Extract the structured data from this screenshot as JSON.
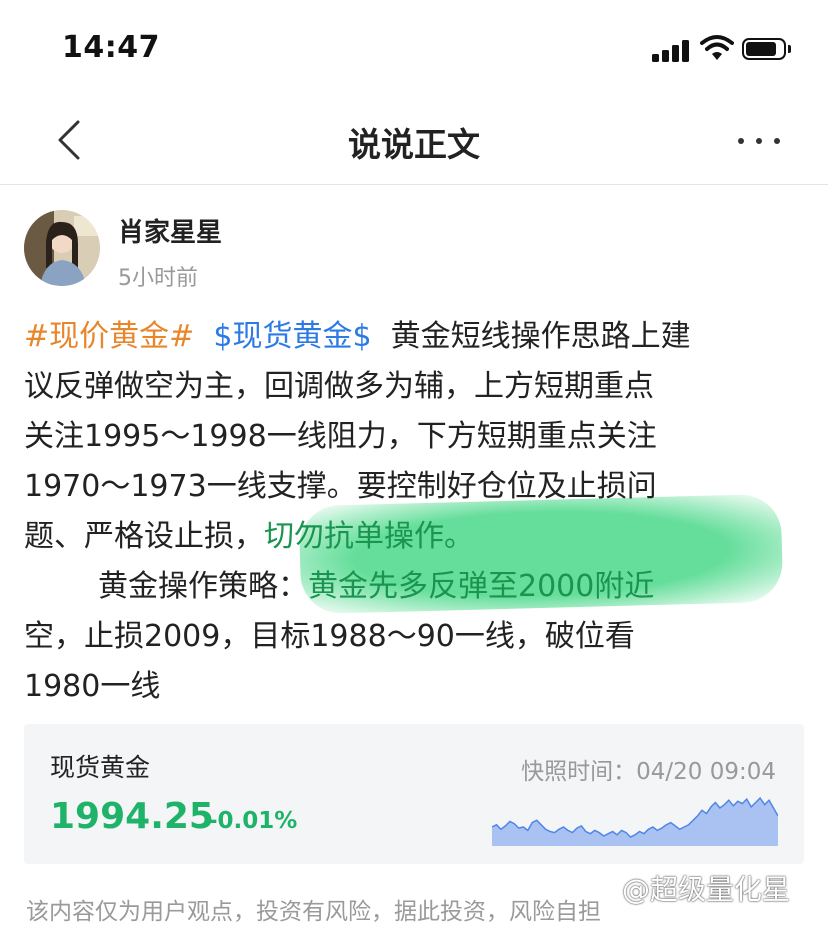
{
  "status_bar": {
    "time": "14:47"
  },
  "nav": {
    "title": "说说正文"
  },
  "author": {
    "name": "肖家星星",
    "posted": "5小时前"
  },
  "post": {
    "topic_tag": "#现价黄金#",
    "stock_tag": "$现货黄金$",
    "para1_a": "黄金短线操作思路上建",
    "para1_b": "议反弹做空为主，回调做多为辅，上方短期重点",
    "para1_c": "关注1995～1998一线阻力，下方短期重点关注",
    "para1_d": "1970～1973一线支撑。要控制好仓位及止损问",
    "para1_e": "题、严格设止损，",
    "para1_e2": "切勿抗单操作。",
    "para2_a": "黄金操作策略：",
    "para2_a2": "黄金先多反弹至2000附近",
    "para2_b": "空，止损2009，目标1988～90一线，破位看",
    "para2_c": "1980一线"
  },
  "quote": {
    "name": "现货黄金",
    "price": "1994.25",
    "change": "-0.01%",
    "snapshot_label": "快照时间：04/20 09:04",
    "spark_color": "#4f86e8",
    "spark_values": [
      40,
      42,
      38,
      41,
      45,
      43,
      39,
      40,
      37,
      44,
      46,
      42,
      38,
      36,
      35,
      38,
      40,
      37,
      35,
      39,
      41,
      36,
      34,
      37,
      35,
      32,
      34,
      36,
      33,
      37,
      35,
      31,
      33,
      36,
      34,
      38,
      40,
      37,
      39,
      42,
      44,
      41,
      38,
      40,
      42,
      46,
      50,
      55,
      52,
      58,
      62,
      57,
      60,
      64,
      59,
      63,
      61,
      65,
      58,
      62,
      66,
      60,
      64,
      57,
      50
    ]
  },
  "disclaimer": "该内容仅为用户观点，投资有风险，据此投资，风险自担",
  "watermark": "@超级量化星"
}
